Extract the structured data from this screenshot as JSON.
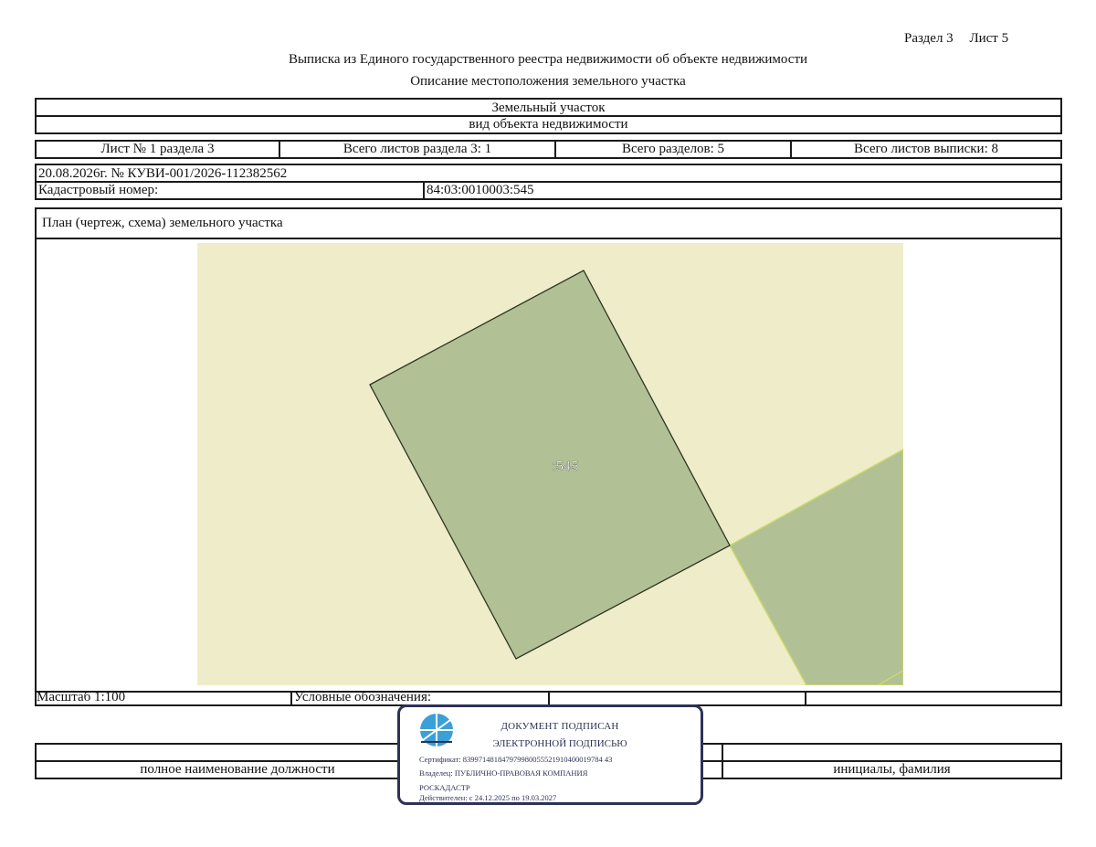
{
  "header": {
    "section": "Раздел 3",
    "sheet": "Лист 5",
    "title": "Выписка из Единого государственного реестра недвижимости об объекте недвижимости",
    "subtitle": "Описание местоположения земельного участка"
  },
  "object": {
    "type": "Земельный участок",
    "type_caption": "вид объекта недвижимости"
  },
  "sheets_row": {
    "sheet_no": "Лист № 1 раздела 3",
    "total_sheets_section": "Всего листов раздела 3: 1",
    "total_sections": "Всего разделов: 5",
    "total_sheets_extract": "Всего листов выписки: 8"
  },
  "record": {
    "date_number": "20.08.2026г. № КУВИ-001/2026-112382562",
    "cadastral_label": "Кадастровый номер:",
    "cadastral_value": "84:03:0010003:545"
  },
  "plan": {
    "title": "План (чертеж, схема) земельного участка",
    "parcel_label": ":545",
    "colors": {
      "background": "#efecc9",
      "parcel_fill": "#b2c096",
      "parcel_stroke": "#2b3520",
      "neighbor_fill": "#b2c096",
      "neighbor_stroke": "#c9d96a"
    }
  },
  "footer": {
    "scale": "Масштаб 1:100",
    "legend_label": "Условные обозначения:",
    "position_caption": "полное наименование должности",
    "initials_caption": "инициалы, фамилия"
  },
  "stamp": {
    "line1": "ДОКУМЕНТ ПОДПИСАН",
    "line2": "ЭЛЕКТРОННОЙ ПОДПИСЬЮ",
    "certificate": "Сертификат: 839971481847979980055521910400019784 43",
    "owner1": "Владелец: ПУБЛИЧНО-ПРАВОВАЯ КОМПАНИЯ",
    "owner2": "РОСКАДАСТР",
    "valid": "Действителен: с 24.12.2025 по 19.03.2027",
    "color": "#2e3158",
    "logo_color": "#3aa0d8"
  }
}
